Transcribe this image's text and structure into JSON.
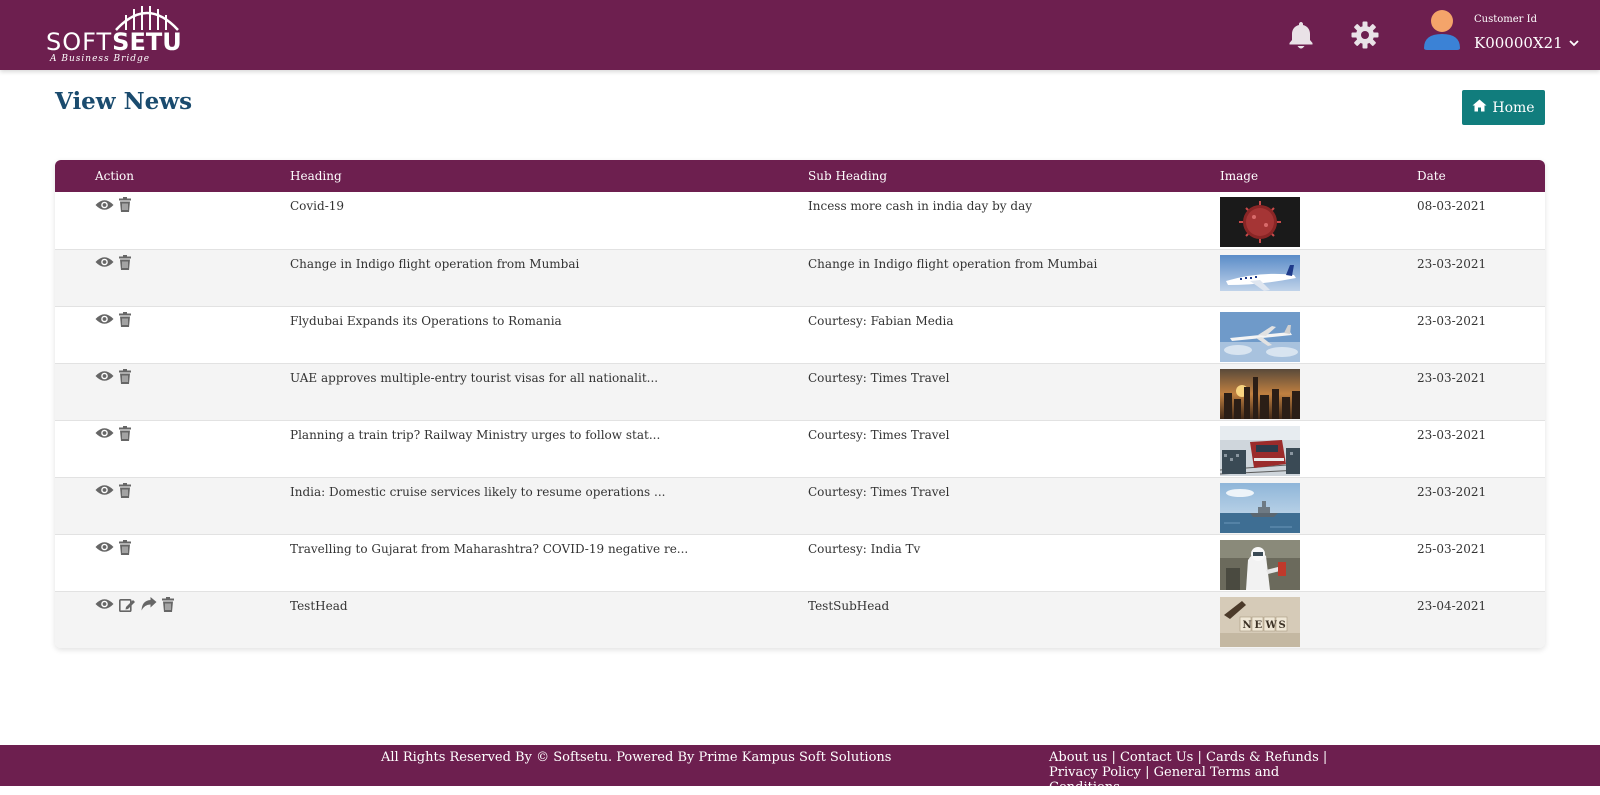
{
  "header": {
    "brand_light": "SOFT",
    "brand_bold": "SETU",
    "tagline": "A Business Bridge",
    "customer_label": "Customer Id",
    "customer_id": "K00000X21"
  },
  "page": {
    "title": "View News",
    "home_button": "Home"
  },
  "table": {
    "columns": [
      "Action",
      "Heading",
      "Sub Heading",
      "Image",
      "Date"
    ],
    "rows": [
      {
        "heading": "Covid-19",
        "subheading": "Incess more cash in india day by day",
        "image": "virus",
        "date": "08-03-2021",
        "actions": [
          "view",
          "delete"
        ]
      },
      {
        "heading": "Change in Indigo flight operation from Mumbai",
        "subheading": "Change in Indigo flight operation from Mumbai",
        "image": "plane-indigo",
        "date": "23-03-2021",
        "actions": [
          "view",
          "delete"
        ]
      },
      {
        "heading": "Flydubai Expands its Operations to Romania",
        "subheading": "Courtesy: Fabian Media",
        "image": "plane-sky",
        "date": "23-03-2021",
        "actions": [
          "view",
          "delete"
        ]
      },
      {
        "heading": "UAE approves multiple-entry tourist visas for all nationalit...",
        "subheading": "Courtesy: Times Travel",
        "image": "city-skyline",
        "date": "23-03-2021",
        "actions": [
          "view",
          "delete"
        ]
      },
      {
        "heading": "Planning a train trip? Railway Ministry urges to follow stat...",
        "subheading": "Courtesy: Times Travel",
        "image": "train",
        "date": "23-03-2021",
        "actions": [
          "view",
          "delete"
        ]
      },
      {
        "heading": "India: Domestic cruise services likely to resume operations ...",
        "subheading": "Courtesy: Times Travel",
        "image": "ship",
        "date": "23-03-2021",
        "actions": [
          "view",
          "delete"
        ]
      },
      {
        "heading": "Travelling to Gujarat from Maharashtra? COVID-19 negative re...",
        "subheading": "Courtesy: India Tv",
        "image": "covid-test",
        "date": "25-03-2021",
        "actions": [
          "view",
          "delete"
        ]
      },
      {
        "heading": "TestHead",
        "subheading": "TestSubHead",
        "image": "news-blocks",
        "date": "23-04-2021",
        "actions": [
          "view",
          "edit",
          "share",
          "delete"
        ]
      }
    ]
  },
  "footer": {
    "copyright": "All Rights Reserved By © Softsetu. Powered By Prime Kampus Soft Solutions",
    "links": [
      "About us",
      "Contact Us",
      "Cards & Refunds",
      "Privacy Policy",
      "General Terms and Conditions"
    ]
  },
  "colors": {
    "brand": "#6d1f4f",
    "title": "#1a4b6e",
    "home_button": "#117d7d",
    "icon_gray": "#666666"
  }
}
